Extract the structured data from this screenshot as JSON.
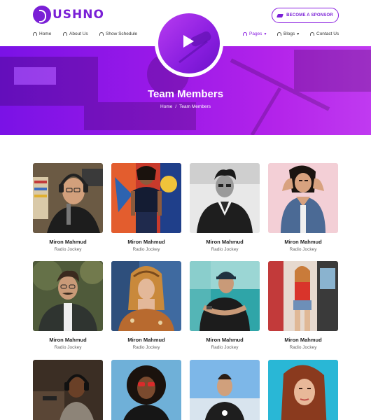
{
  "header": {
    "logo_text": "USHNO",
    "sponsor_button": "BECOME A SPONSOR",
    "nav": [
      {
        "label": "Home"
      },
      {
        "label": "About Us"
      },
      {
        "label": "Show Schedule"
      },
      {
        "label": "Pages"
      },
      {
        "label": "Blogs"
      },
      {
        "label": "Contact Us"
      }
    ]
  },
  "hero": {
    "title": "Team Members",
    "breadcrumb": {
      "home": "Home",
      "separator": "/",
      "current": "Team Members"
    }
  },
  "team": [
    {
      "name": "Miron Mahmud",
      "role": "Radio Jockey"
    },
    {
      "name": "Miron Mahmud",
      "role": "Radio Jockey"
    },
    {
      "name": "Miron Mahmud",
      "role": "Radio Jockey"
    },
    {
      "name": "Miron Mahmud",
      "role": "Radio Jockey"
    },
    {
      "name": "Miron Mahmud",
      "role": "Radio Jockey"
    },
    {
      "name": "Miron Mahmud",
      "role": "Radio Jockey"
    },
    {
      "name": "Miron Mahmud",
      "role": "Radio Jockey"
    },
    {
      "name": "Miron Mahmud",
      "role": "Radio Jockey"
    },
    {
      "name": "",
      "role": ""
    },
    {
      "name": "",
      "role": ""
    },
    {
      "name": "",
      "role": ""
    },
    {
      "name": "",
      "role": ""
    }
  ],
  "colors": {
    "accent": "#8a1fe0",
    "hero_start": "#7a12e6",
    "hero_end": "#c03af0"
  }
}
